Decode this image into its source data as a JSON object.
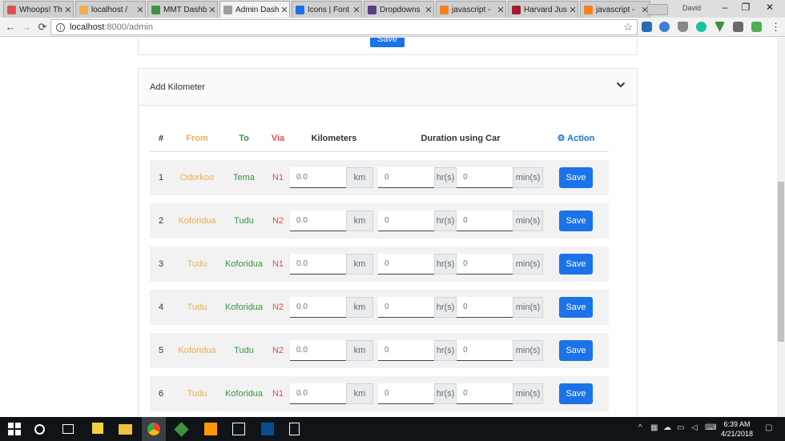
{
  "browser": {
    "tabs": [
      {
        "title": "Whoops! Th",
        "color": "#d9534f"
      },
      {
        "title": "localhost / ",
        "color": "#f0ad4e"
      },
      {
        "title": "MMT Dashb",
        "color": "#3d9140"
      },
      {
        "title": "Admin Dash",
        "color": "#9e9e9e",
        "active": true
      },
      {
        "title": "Icons | Font",
        "color": "#1a73e8"
      },
      {
        "title": "Dropdowns",
        "color": "#563d7c"
      },
      {
        "title": "javascript - ",
        "color": "#f48024"
      },
      {
        "title": "Harvard Jus",
        "color": "#a51c30"
      },
      {
        "title": "javascript - ",
        "color": "#f48024"
      }
    ],
    "close_glyph": "✕",
    "profile_name": "David",
    "url_host": "localhost",
    "url_path": ":8000/admin"
  },
  "previous_card": {
    "save_label": "Save"
  },
  "card": {
    "title": "Add Kilometer",
    "columns": {
      "num": "#",
      "from": "From",
      "to": "To",
      "via": "Via",
      "kilometers": "Kilometers",
      "duration": "Duration using Car",
      "action": "Action"
    },
    "unit_km": "km",
    "unit_hr": "hr(s)",
    "unit_min": "min(s)",
    "km_placeholder": "0.0",
    "hr_placeholder": "0",
    "min_placeholder": "0",
    "save_label": "Save",
    "rows": [
      {
        "num": "1",
        "from": "Odorkoo",
        "to": "Tema",
        "via": "N1"
      },
      {
        "num": "2",
        "from": "Koforidua",
        "to": "Tudu",
        "via": "N2"
      },
      {
        "num": "3",
        "from": "Tudu",
        "to": "Koforidua",
        "via": "N1"
      },
      {
        "num": "4",
        "from": "Tudu",
        "to": "Koforidua",
        "via": "N2"
      },
      {
        "num": "5",
        "from": "Koforidua",
        "to": "Tudu",
        "via": "N2"
      },
      {
        "num": "6",
        "from": "Tudu",
        "to": "Koforidua",
        "via": "N1"
      }
    ]
  },
  "taskbar": {
    "time": "6:39 AM",
    "date": "4/21/2018"
  },
  "colors": {
    "primary": "#1a73e8",
    "from": "#f0ad4e",
    "to": "#3d9140",
    "via": "#d9534f"
  }
}
